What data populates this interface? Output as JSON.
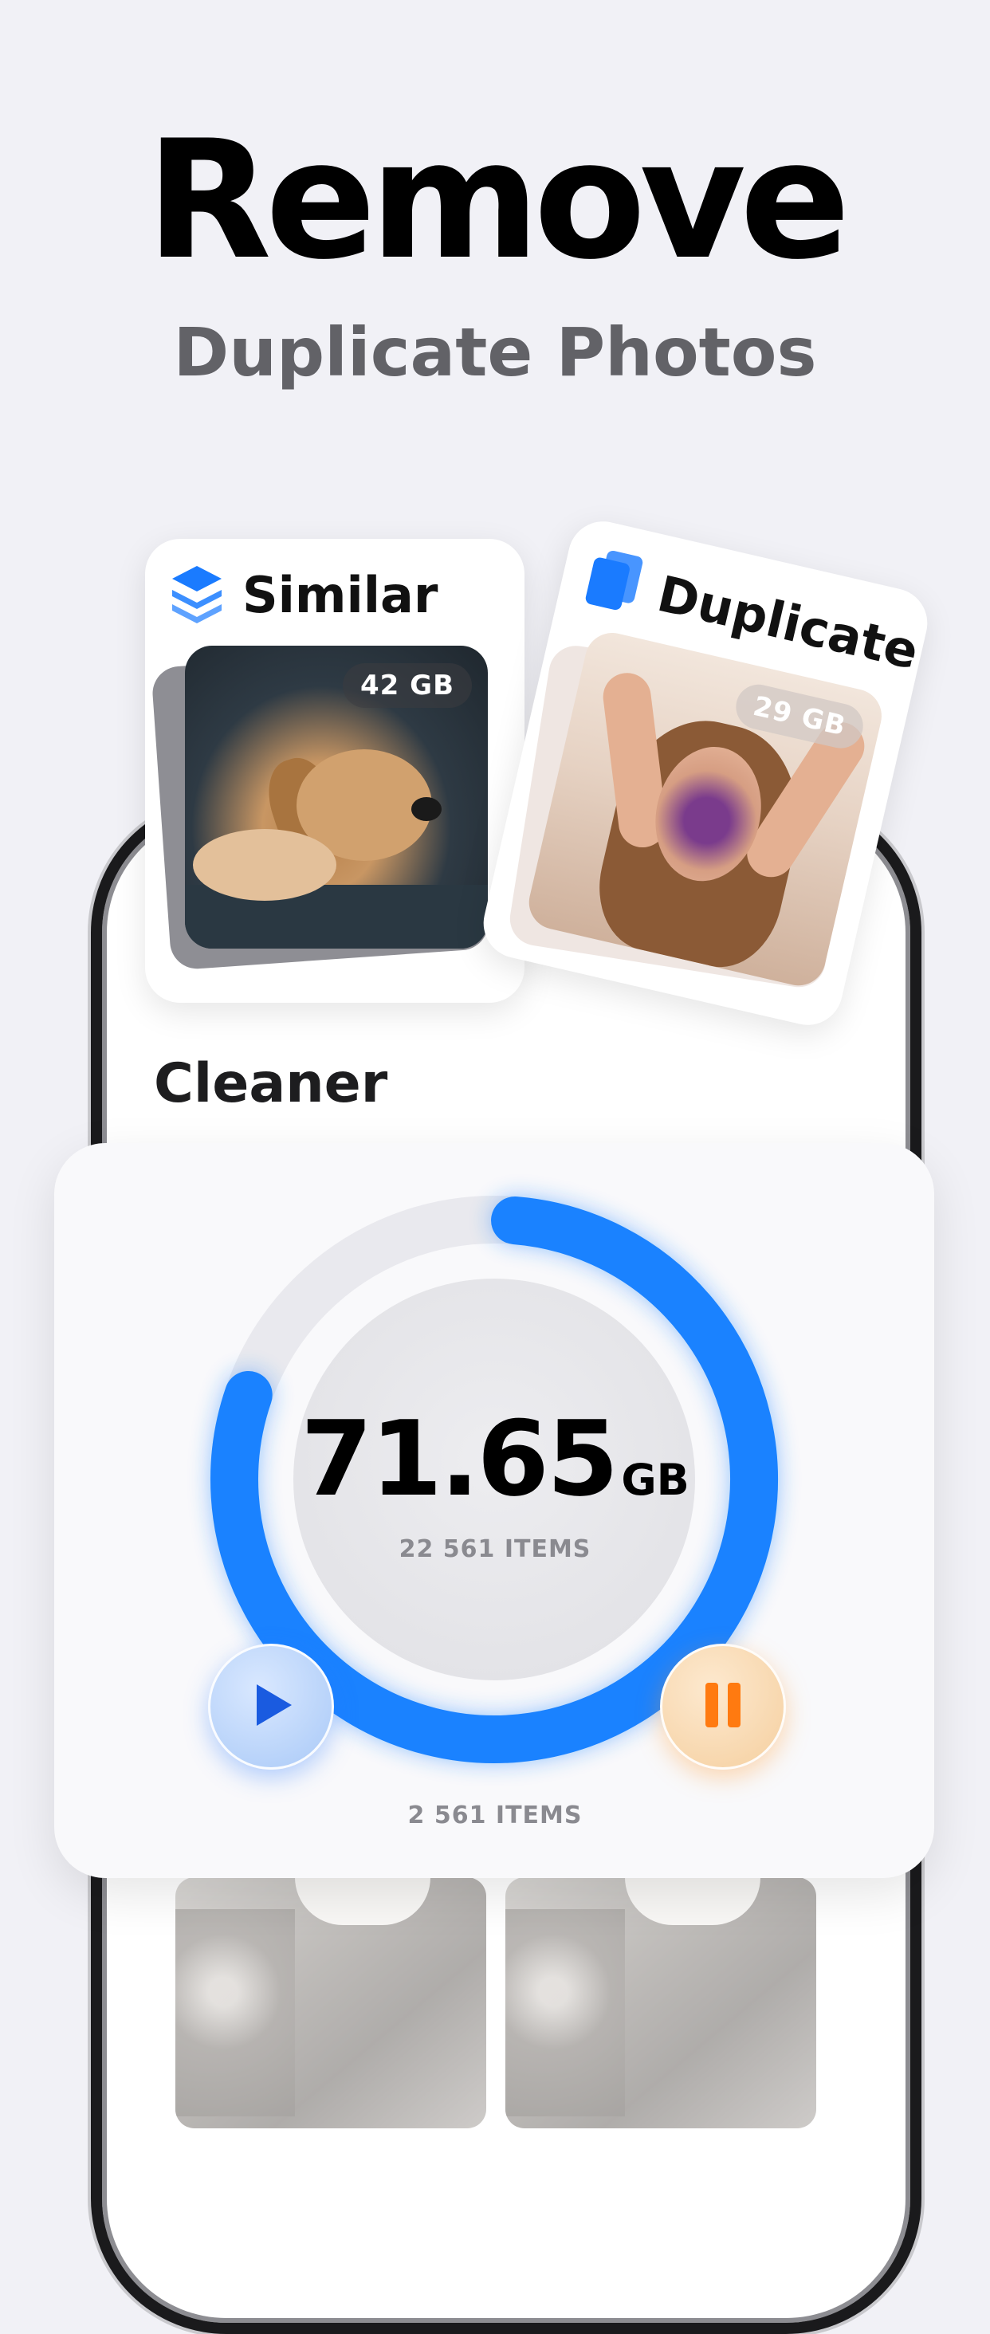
{
  "header": {
    "title": "Remove",
    "subtitle": "Duplicate Photos"
  },
  "cards": {
    "similar": {
      "title": "Similar",
      "badge": "42 GB",
      "icon": "layers-icon"
    },
    "duplicate": {
      "title": "Duplicate",
      "badge": "29 GB",
      "icon": "duplicate-files-icon"
    }
  },
  "screen": {
    "title": "Cleaner"
  },
  "stats": {
    "value": "71.65",
    "unit": "GB",
    "items_total": "22 561 ITEMS",
    "items_selected": "2 561 ITEMS",
    "progress": 0.79,
    "ring_color": "#1a82ff",
    "play_icon_color": "#1a5be0",
    "pause_icon_color": "#ff7a10"
  }
}
